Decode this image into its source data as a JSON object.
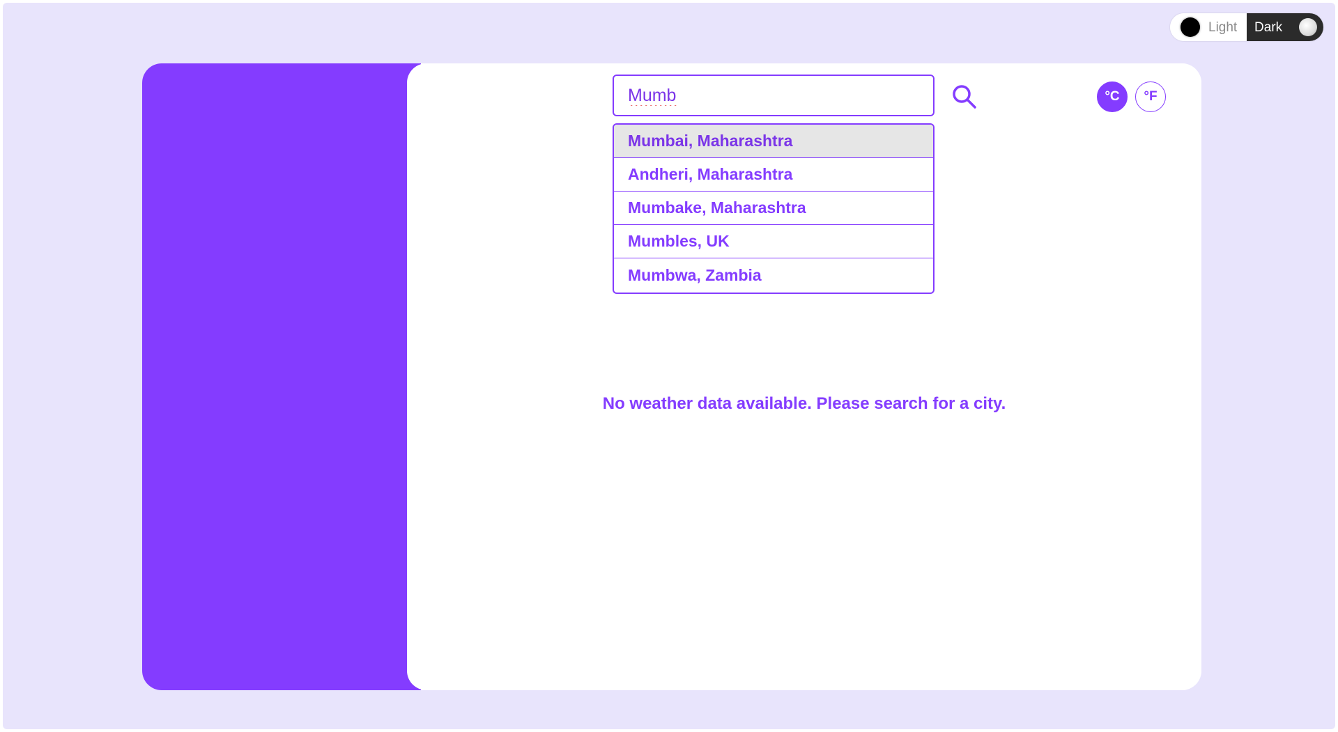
{
  "theme_toggle": {
    "light_label": "Light",
    "dark_label": "Dark"
  },
  "search": {
    "value": "Mumb",
    "suggestions": [
      "Mumbai, Maharashtra",
      "Andheri, Maharashtra",
      "Mumbake, Maharashtra",
      "Mumbles, UK",
      "Mumbwa, Zambia"
    ],
    "search_icon": "search-icon"
  },
  "units": {
    "celsius": "°C",
    "fahrenheit": "°F",
    "selected": "°C"
  },
  "main": {
    "empty_message": "No weather data available. Please search for a city."
  },
  "colors": {
    "accent": "#843cff",
    "background": "#e8e4fc",
    "dropdown_highlight": "#e6e6e6",
    "dark_toggle": "#2b2b2b"
  }
}
